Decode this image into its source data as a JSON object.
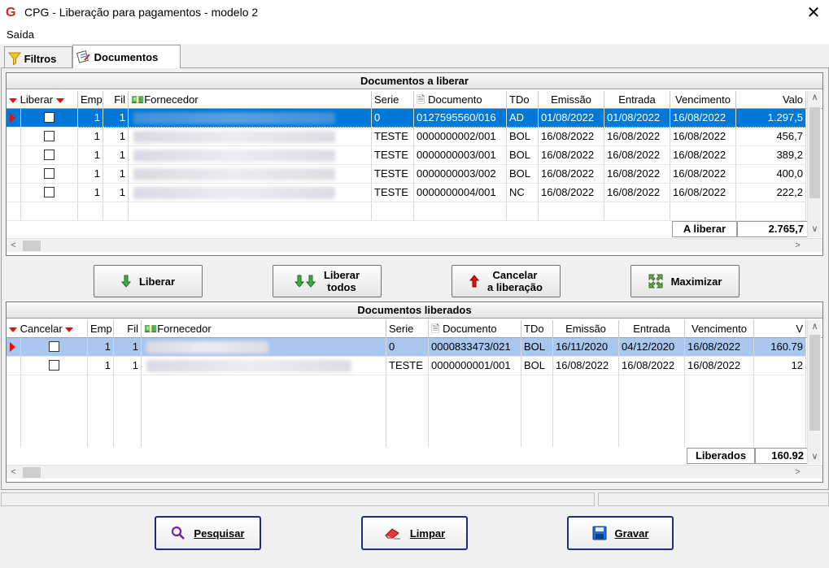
{
  "window": {
    "icon": "G",
    "title": "CPG - Liberação para pagamentos - modelo 2",
    "close": "✕"
  },
  "menu": {
    "saida": "Saída"
  },
  "tabs": [
    {
      "label": "Filtros",
      "icon": "funnel-icon"
    },
    {
      "label": "Documentos",
      "icon": "documents-icon"
    }
  ],
  "liberar_grid": {
    "title": "Documentos a liberar",
    "headers": [
      "Liberar",
      "Emp",
      "Fil",
      "Fornecedor",
      "Serie",
      "Documento",
      "TDo",
      "Emissão",
      "Entrada",
      "Vencimento",
      "Valo"
    ],
    "rows": [
      {
        "emp": "1",
        "fil": "1",
        "serie": "0",
        "documento": "0127595560/016",
        "tdo": "AD",
        "emissao": "01/08/2022",
        "entrada": "01/08/2022",
        "vencimento": "16/08/2022",
        "valor": "1.297,5"
      },
      {
        "emp": "1",
        "fil": "1",
        "serie": "TESTE",
        "documento": "0000000002/001",
        "tdo": "BOL",
        "emissao": "16/08/2022",
        "entrada": "16/08/2022",
        "vencimento": "16/08/2022",
        "valor": "456,7"
      },
      {
        "emp": "1",
        "fil": "1",
        "serie": "TESTE",
        "documento": "0000000003/001",
        "tdo": "BOL",
        "emissao": "16/08/2022",
        "entrada": "16/08/2022",
        "vencimento": "16/08/2022",
        "valor": "389,2"
      },
      {
        "emp": "1",
        "fil": "1",
        "serie": "TESTE",
        "documento": "0000000003/002",
        "tdo": "BOL",
        "emissao": "16/08/2022",
        "entrada": "16/08/2022",
        "vencimento": "16/08/2022",
        "valor": "400,0"
      },
      {
        "emp": "1",
        "fil": "1",
        "serie": "TESTE",
        "documento": "0000000004/001",
        "tdo": "NC",
        "emissao": "16/08/2022",
        "entrada": "16/08/2022",
        "vencimento": "16/08/2022",
        "valor": "222,2"
      }
    ],
    "total_label": "A liberar",
    "total_value": "2.765,7"
  },
  "actions": {
    "liberar": "Liberar",
    "liberar_todos_1": "Liberar",
    "liberar_todos_2": "todos",
    "cancelar_1": "Cancelar",
    "cancelar_2": "a liberação",
    "maximizar": "Maximizar"
  },
  "liberados_grid": {
    "title": "Documentos liberados",
    "headers": [
      "Cancelar",
      "Emp",
      "Fil",
      "Fornecedor",
      "Serie",
      "Documento",
      "TDo",
      "Emissão",
      "Entrada",
      "Vencimento",
      "V"
    ],
    "rows": [
      {
        "emp": "1",
        "fil": "1",
        "serie": "0",
        "documento": "0000833473/021",
        "tdo": "BOL",
        "emissao": "16/11/2020",
        "entrada": "04/12/2020",
        "vencimento": "16/08/2022",
        "valor": "160.79"
      },
      {
        "emp": "1",
        "fil": "1",
        "serie": "TESTE",
        "documento": "0000000001/001",
        "tdo": "BOL",
        "emissao": "16/08/2022",
        "entrada": "16/08/2022",
        "vencimento": "16/08/2022",
        "valor": "12"
      }
    ],
    "total_label": "Liberados",
    "total_value": "160.92"
  },
  "footer": {
    "pesquisar": "Pesquisar",
    "limpar": "Limpar",
    "gravar": "Gravar"
  },
  "colors": {
    "selection": "#0078d7",
    "selection_secondary": "#a9c6ef",
    "accent_red": "#e01010",
    "button_border": "#1f2d7a"
  }
}
